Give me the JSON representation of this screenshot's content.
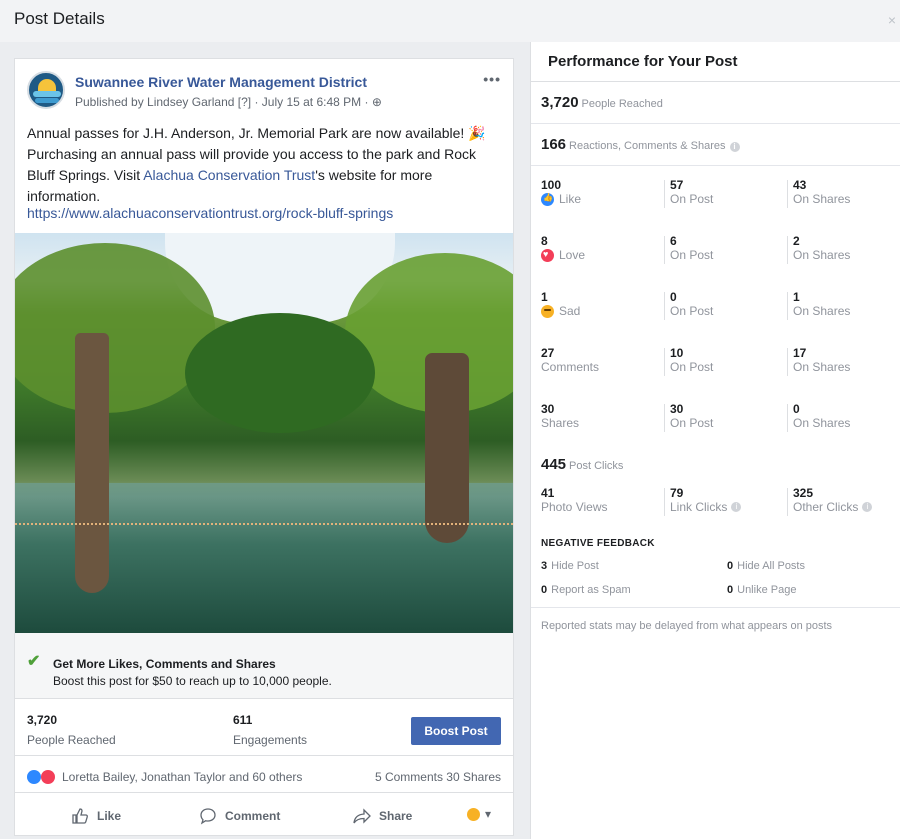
{
  "dialog": {
    "title": "Post Details",
    "close_label": "×"
  },
  "post": {
    "page_name": "Suwannee River Water Management District",
    "meta": "Published by Lindsey Garland [?] · July 15 at 6:48 PM · ⊕",
    "more": "•••",
    "text_before": "Annual passes for J.H. Anderson, Jr. Memorial Park are now available! 🎉 Purchasing an annual pass will provide you access to the park and Rock Bluff Springs. Visit ",
    "text_link": "Alachua Conservation Trust",
    "text_after": "'s website for more information.",
    "url": "https://www.alachuaconservationtrust.org/rock-bluff-springs"
  },
  "promo": {
    "check": "✔",
    "heading": "Get More Likes, Comments and Shares",
    "sub": "Boost this post for $50 to reach up to 10,000 people."
  },
  "stats": {
    "reached_value": "3,720",
    "reached_label": "People Reached",
    "engagements_value": "611",
    "engagements_label": "Engagements",
    "boost_button": "Boost Post"
  },
  "reactions": {
    "names": "Loretta Bailey, Jonathan Taylor and 60 others",
    "counts": "5 Comments  30 Shares"
  },
  "actions": {
    "like": "Like",
    "comment": "Comment",
    "share": "Share",
    "emoji": "▾"
  },
  "performance": {
    "title": "Performance for Your Post",
    "people_reached_value": "3,720",
    "people_reached_label": "People Reached",
    "rcs_value": "166",
    "rcs_label": "Reactions, Comments & Shares",
    "rows": [
      {
        "icon": "like",
        "total": "100",
        "label": "Like",
        "on_post": "57",
        "on_post_label": "On Post",
        "on_shares": "43",
        "on_shares_label": "On Shares"
      },
      {
        "icon": "love",
        "total": "8",
        "label": "Love",
        "on_post": "6",
        "on_post_label": "On Post",
        "on_shares": "2",
        "on_shares_label": "On Shares"
      },
      {
        "icon": "sad",
        "total": "1",
        "label": "Sad",
        "on_post": "0",
        "on_post_label": "On Post",
        "on_shares": "1",
        "on_shares_label": "On Shares"
      },
      {
        "icon": "",
        "total": "27",
        "label": "Comments",
        "on_post": "10",
        "on_post_label": "On Post",
        "on_shares": "17",
        "on_shares_label": "On Shares"
      },
      {
        "icon": "",
        "total": "30",
        "label": "Shares",
        "on_post": "30",
        "on_post_label": "On Post",
        "on_shares": "0",
        "on_shares_label": "On Shares"
      }
    ],
    "post_clicks_value": "445",
    "post_clicks_label": "Post Clicks",
    "clicks": {
      "photo_views_value": "41",
      "photo_views_label": "Photo Views",
      "link_clicks_value": "79",
      "link_clicks_label": "Link Clicks",
      "other_clicks_value": "325",
      "other_clicks_label": "Other Clicks"
    },
    "negative": {
      "title": "NEGATIVE FEEDBACK",
      "hide_post_value": "3",
      "hide_post_label": "Hide Post",
      "hide_all_value": "0",
      "hide_all_label": "Hide All Posts",
      "spam_value": "0",
      "spam_label": "Report as Spam",
      "unlike_value": "0",
      "unlike_label": "Unlike Page"
    },
    "note": "Reported stats may be delayed from what appears on posts"
  },
  "colors": {
    "brand_blue": "#4267b2",
    "link_blue": "#385898",
    "like_blue": "#2d88ff",
    "love_red": "#f33e58",
    "sad_yellow": "#f7b125"
  }
}
